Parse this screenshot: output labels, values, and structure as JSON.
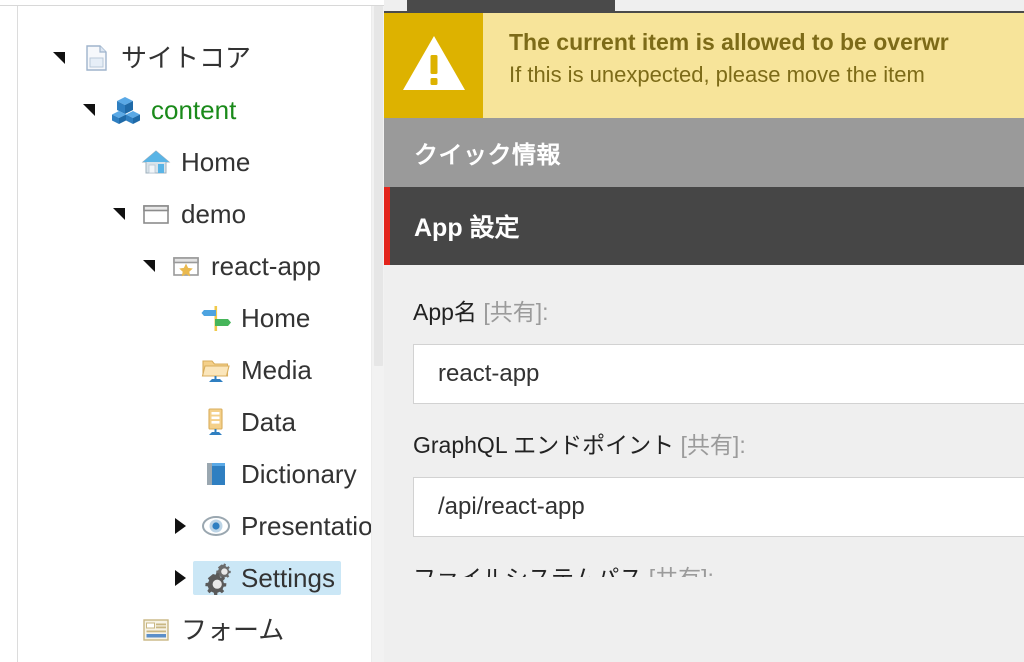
{
  "tree": {
    "items": [
      {
        "label": "サイトコア",
        "icon": "document-icon",
        "indent": 0,
        "twisty": "down",
        "selected": false,
        "color": "default"
      },
      {
        "label": "content",
        "icon": "cubes-icon",
        "indent": 1,
        "twisty": "down",
        "selected": false,
        "color": "green"
      },
      {
        "label": "Home",
        "icon": "house-icon",
        "indent": 2,
        "twisty": "none",
        "selected": false,
        "color": "default"
      },
      {
        "label": "demo",
        "icon": "window-icon",
        "indent": 2,
        "twisty": "down",
        "selected": false,
        "color": "default"
      },
      {
        "label": "react-app",
        "icon": "star-window-icon",
        "indent": 3,
        "twisty": "down",
        "selected": false,
        "color": "default"
      },
      {
        "label": "Home",
        "icon": "signpost-icon",
        "indent": 4,
        "twisty": "none",
        "selected": false,
        "color": "default"
      },
      {
        "label": "Media",
        "icon": "media-folder-icon",
        "indent": 4,
        "twisty": "none",
        "selected": false,
        "color": "default"
      },
      {
        "label": "Data",
        "icon": "data-icon",
        "indent": 4,
        "twisty": "none",
        "selected": false,
        "color": "default"
      },
      {
        "label": "Dictionary",
        "icon": "book-icon",
        "indent": 4,
        "twisty": "none",
        "selected": false,
        "color": "default"
      },
      {
        "label": "Presentation",
        "icon": "eye-icon",
        "indent": 4,
        "twisty": "right",
        "selected": false,
        "color": "default"
      },
      {
        "label": "Settings",
        "icon": "gears-icon",
        "indent": 4,
        "twisty": "right",
        "selected": true,
        "color": "default"
      },
      {
        "label": "フォーム",
        "icon": "form-icon",
        "indent": 2,
        "twisty": "none",
        "selected": false,
        "color": "default"
      }
    ]
  },
  "warning": {
    "icon": "warning-triangle-icon",
    "title": "The current item is allowed to be overwr",
    "subtitle": "If this is unexpected, please move the item",
    "bg_color": "#f7e49a",
    "icon_bg_color": "#ddb200",
    "text_color": "#7d6b18"
  },
  "quick_info": {
    "title": "クイック情報",
    "bg_color": "#9a9a9a"
  },
  "section": {
    "title": "App 設定",
    "bg_color": "#464646",
    "accent_color": "#e3241b"
  },
  "fields": [
    {
      "label_main": "App名 ",
      "label_shared": "[共有]:",
      "value": "react-app",
      "name": "app-name"
    },
    {
      "label_main": "GraphQL エンドポイント ",
      "label_shared": "[共有]:",
      "value": "/api/react-app",
      "name": "graphql-endpoint"
    }
  ],
  "cut_field": {
    "label_main": "ファイルシステムパス ",
    "label_shared": "[共有]:"
  }
}
